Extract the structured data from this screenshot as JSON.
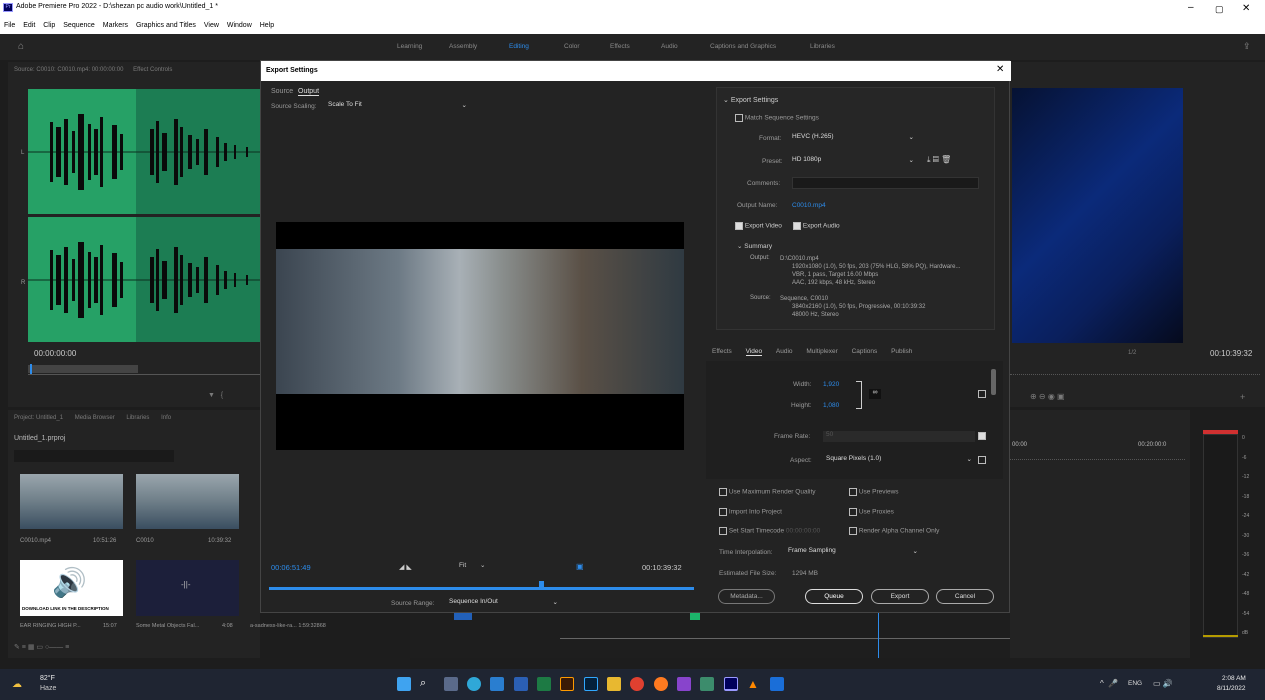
{
  "app": {
    "title": "Adobe Premiere Pro 2022 - D:\\shezan pc audio work\\Untitled_1 *",
    "logo": "Pr",
    "menu": [
      "File",
      "Edit",
      "Clip",
      "Sequence",
      "Markers",
      "Graphics and Titles",
      "View",
      "Window",
      "Help"
    ]
  },
  "workspaces": [
    "Learning",
    "Assembly",
    "Editing",
    "Color",
    "Effects",
    "Audio",
    "Captions and Graphics",
    "Libraries"
  ],
  "source_panel": {
    "tab": "Source: C0010: C0010.mp4: 00:00:00:00",
    "tab2": "Effect Controls",
    "timecode": "00:00:00:00",
    "ch_l": "L",
    "ch_r": "R"
  },
  "program_panel": {
    "timecode": "00:10:39:32",
    "fit": "1/2"
  },
  "project": {
    "tabs": [
      "Project: Untitled_1",
      "Media Browser",
      "Libraries",
      "Info"
    ],
    "file": "Untitled_1.prproj",
    "items": [
      {
        "name": "C0010.mp4",
        "dur": "10:51:26"
      },
      {
        "name": "C0010",
        "dur": "10:39:32"
      },
      {
        "name": "EAR RINGING HIGH P...",
        "dur": "15:07"
      },
      {
        "name": "Some Metal Objects Fal...",
        "dur": "4:08"
      },
      {
        "name": "a-sadness-like-ra...",
        "dur": "1:59:32868"
      }
    ],
    "thumb_text": "DOWNLOAD LINK IN THE DESCRIPTION"
  },
  "timeline": {
    "t1": "00:00",
    "t2": "00:20:00:0"
  },
  "meter": [
    "0",
    "-6",
    "-12",
    "-18",
    "-24",
    "-30",
    "-36",
    "-42",
    "-48",
    "-54",
    "dB"
  ],
  "dialog": {
    "title": "Export Settings",
    "tabs": [
      "Source",
      "Output"
    ],
    "source_scaling_label": "Source Scaling:",
    "source_scaling": "Scale To Fit",
    "tc_in": "00:06:51:49",
    "tc_out": "00:10:39:32",
    "fit": "Fit",
    "source_range_label": "Source Range:",
    "source_range": "Sequence In/Out",
    "export_settings_header": "Export Settings",
    "match_sequence": "Match Sequence Settings",
    "format_label": "Format:",
    "format": "HEVC (H.265)",
    "preset_label": "Preset:",
    "preset": "HD 1080p",
    "comments_label": "Comments:",
    "output_name_label": "Output Name:",
    "output_name": "C0010.mp4",
    "export_video": "Export Video",
    "export_audio": "Export Audio",
    "summary_header": "Summary",
    "output_label": "Output:",
    "output_lines": [
      "D:\\C0010.mp4",
      "1920x1080 (1.0), 50 fps, 203 (75% HLG, 58% PQ), Hardware...",
      "VBR, 1 pass, Target 16.00 Mbps",
      "AAC, 192 kbps, 48 kHz, Stereo"
    ],
    "source_label": "Source:",
    "source_lines": [
      "Sequence, C0010",
      "3840x2160 (1.0), 50 fps, Progressive, 00:10:39:32",
      "48000 Hz, Stereo"
    ],
    "settings_tabs": [
      "Effects",
      "Video",
      "Audio",
      "Multiplexer",
      "Captions",
      "Publish"
    ],
    "width_label": "Width:",
    "width": "1,920",
    "height_label": "Height:",
    "height": "1,080",
    "frame_rate_label": "Frame Rate:",
    "frame_rate": "50",
    "aspect_label": "Aspect:",
    "aspect": "Square Pixels (1.0)",
    "opt_max_render": "Use Maximum Render Quality",
    "opt_previews": "Use Previews",
    "opt_import": "Import Into Project",
    "opt_proxies": "Use Proxies",
    "opt_start_tc": "Set Start Timecode",
    "start_tc": "00:00:00:00",
    "opt_alpha": "Render Alpha Channel Only",
    "time_interp_label": "Time Interpolation:",
    "time_interp": "Frame Sampling",
    "file_size_label": "Estimated File Size:",
    "file_size": "1294 MB",
    "metadata_btn": "Metadata...",
    "queue_btn": "Queue",
    "export_btn": "Export",
    "cancel_btn": "Cancel"
  },
  "taskbar": {
    "temp": "82°F",
    "weather": "Haze",
    "lang": "ENG",
    "time": "2:08 AM",
    "date": "8/11/2022"
  },
  "colors": {
    "accent_blue": "#2d8ceb",
    "waveform_green": "#1e8a5a",
    "dialog_bg": "#232323"
  }
}
